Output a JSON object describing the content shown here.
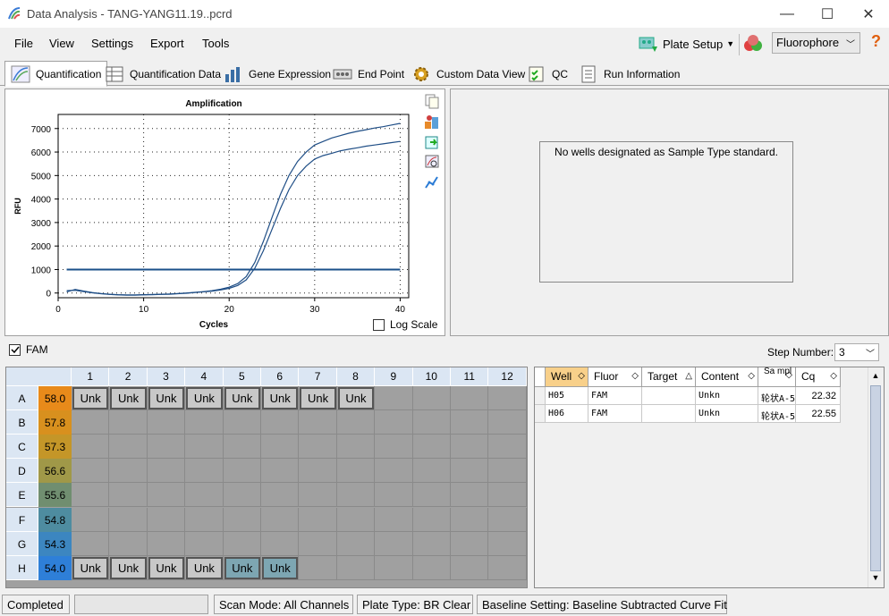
{
  "window": {
    "title": "Data Analysis - TANG-YANG11.19..pcrd",
    "minimize": "—",
    "maximize": "☐",
    "close": "✕"
  },
  "menu": {
    "items": [
      "File",
      "View",
      "Settings",
      "Export",
      "Tools"
    ],
    "plate_setup": "Plate Setup",
    "fluorophore": "Fluorophore",
    "help": "?"
  },
  "tabs": [
    "Quantification",
    "Quantification Data",
    "Gene Expression",
    "End Point",
    "Custom Data View",
    "QC",
    "Run Information"
  ],
  "active_tab": "Quantification",
  "chart_data": {
    "type": "line",
    "title": "Amplification",
    "xlabel": "Cycles",
    "ylabel": "RFU",
    "xlim": [
      0,
      41
    ],
    "ylim": [
      -200,
      7600
    ],
    "xticks": [
      0,
      10,
      20,
      30,
      40
    ],
    "yticks": [
      0,
      1000,
      2000,
      3000,
      4000,
      5000,
      6000,
      7000
    ],
    "grid": true,
    "threshold": 1000,
    "series": [
      {
        "x": [
          1,
          2,
          3,
          4,
          5,
          6,
          7,
          8,
          9,
          10,
          11,
          12,
          13,
          14,
          15,
          16,
          17,
          18,
          19,
          20,
          21,
          22,
          23,
          24,
          25,
          26,
          27,
          28,
          29,
          30,
          31,
          32,
          33,
          34,
          35,
          36,
          37,
          38,
          39,
          40
        ],
        "values": [
          50,
          150,
          80,
          20,
          -20,
          -50,
          -70,
          -80,
          -80,
          -70,
          -60,
          -50,
          -40,
          -20,
          0,
          30,
          60,
          100,
          160,
          250,
          400,
          700,
          1300,
          2200,
          3200,
          4200,
          5000,
          5600,
          6000,
          6300,
          6450,
          6600,
          6700,
          6800,
          6880,
          6950,
          7020,
          7080,
          7150,
          7220
        ]
      },
      {
        "x": [
          1,
          2,
          3,
          4,
          5,
          6,
          7,
          8,
          9,
          10,
          11,
          12,
          13,
          14,
          15,
          16,
          17,
          18,
          19,
          20,
          21,
          22,
          23,
          24,
          25,
          26,
          27,
          28,
          29,
          30,
          31,
          32,
          33,
          34,
          35,
          36,
          37,
          38,
          39,
          40
        ],
        "values": [
          100,
          120,
          60,
          10,
          -30,
          -60,
          -80,
          -90,
          -90,
          -80,
          -70,
          -60,
          -50,
          -30,
          -10,
          20,
          50,
          80,
          130,
          200,
          320,
          560,
          1050,
          1800,
          2700,
          3600,
          4400,
          5000,
          5400,
          5700,
          5850,
          5950,
          6050,
          6120,
          6180,
          6250,
          6300,
          6350,
          6400,
          6450
        ]
      }
    ]
  },
  "side_icons": [
    "copy-icon",
    "chart-settings-icon",
    "export-icon",
    "zoom-icon",
    "curve-icon"
  ],
  "log_scale": {
    "label": "Log Scale",
    "checked": false
  },
  "std_curve_message": "No wells designated as Sample Type standard.",
  "fam": {
    "label": "FAM",
    "checked": true
  },
  "step": {
    "label": "Step Number:",
    "value": "3"
  },
  "plate": {
    "cols": [
      "1",
      "2",
      "3",
      "4",
      "5",
      "6",
      "7",
      "8",
      "9",
      "10",
      "11",
      "12"
    ],
    "rows": [
      "A",
      "B",
      "C",
      "D",
      "E",
      "F",
      "G",
      "H"
    ],
    "temps": [
      "58.0",
      "57.8",
      "57.3",
      "56.6",
      "55.6",
      "54.8",
      "54.3",
      "54.0"
    ],
    "temp_colors": [
      "#e88a1a",
      "#d8901e",
      "#c49628",
      "#a09848",
      "#708e70",
      "#4e8ca0",
      "#3c86c0",
      "#2e7fd8"
    ],
    "wells": [
      {
        "row": 0,
        "col": 0,
        "label": "Unk",
        "sel": false
      },
      {
        "row": 0,
        "col": 1,
        "label": "Unk",
        "sel": false
      },
      {
        "row": 0,
        "col": 2,
        "label": "Unk",
        "sel": false
      },
      {
        "row": 0,
        "col": 3,
        "label": "Unk",
        "sel": false
      },
      {
        "row": 0,
        "col": 4,
        "label": "Unk",
        "sel": false
      },
      {
        "row": 0,
        "col": 5,
        "label": "Unk",
        "sel": false
      },
      {
        "row": 0,
        "col": 6,
        "label": "Unk",
        "sel": false
      },
      {
        "row": 0,
        "col": 7,
        "label": "Unk",
        "sel": false
      },
      {
        "row": 7,
        "col": 0,
        "label": "Unk",
        "sel": false
      },
      {
        "row": 7,
        "col": 1,
        "label": "Unk",
        "sel": false
      },
      {
        "row": 7,
        "col": 2,
        "label": "Unk",
        "sel": false
      },
      {
        "row": 7,
        "col": 3,
        "label": "Unk",
        "sel": false
      },
      {
        "row": 7,
        "col": 4,
        "label": "Unk",
        "sel": true
      },
      {
        "row": 7,
        "col": 5,
        "label": "Unk",
        "sel": true
      }
    ]
  },
  "results": {
    "headers": [
      "Well",
      "Fluor",
      "Target",
      "Content",
      "Sa mpl",
      "Cq"
    ],
    "rows": [
      [
        "H05",
        "FAM",
        "",
        "Unkn",
        "轮状A-5",
        "22.32"
      ],
      [
        "H06",
        "FAM",
        "",
        "Unkn",
        "轮状A-5",
        "22.55"
      ]
    ]
  },
  "status": {
    "state": "Completed",
    "scan_mode": "Scan Mode: All Channels",
    "plate_type": "Plate Type: BR Clear",
    "baseline": "Baseline Setting: Baseline Subtracted Curve Fit"
  }
}
